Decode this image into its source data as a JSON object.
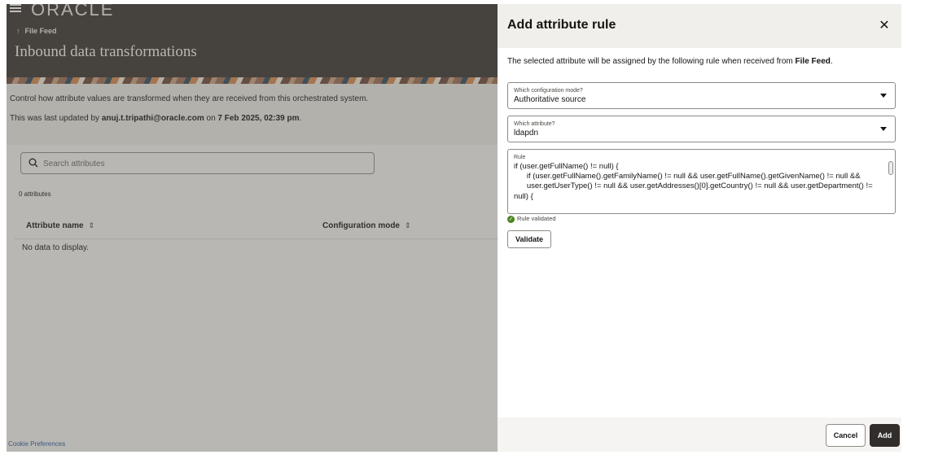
{
  "header": {
    "logo_text": "ORACLE",
    "breadcrumb": "File Feed",
    "page_title": "Inbound data transformations"
  },
  "main": {
    "description": "Control how attribute values are transformed when they are received from this orchestrated system.",
    "last_updated_prefix": "This was last updated by ",
    "last_updated_user": "anuj.t.tripathi@oracle.com",
    "last_updated_on": " on ",
    "last_updated_date": "7 Feb 2025, 02:39 pm",
    "last_updated_suffix": ".",
    "search_placeholder": "Search attributes",
    "attribute_count": "0 attributes",
    "columns": [
      "Attribute name",
      "Configuration mode"
    ],
    "empty_message": "No data to display.",
    "cookie_link": "Cookie Preferences"
  },
  "drawer": {
    "title": "Add attribute rule",
    "intro_prefix": "The selected attribute will be assigned by the following rule when received from ",
    "intro_source": "File Feed",
    "intro_suffix": ".",
    "config_mode_label": "Which configuration mode?",
    "config_mode_value": "Authoritative source",
    "attribute_label": "Which attribute?",
    "attribute_value": "ldapdn",
    "rule_label": "Rule",
    "rule_text": "if (user.getFullName() != null) {\n      if (user.getFullName().getFamilyName() != null && user.getFullName().getGivenName() != null &&\n      user.getUserType() != null && user.getAddresses()[0].getCountry() != null && user.getDepartment() != null) {",
    "rule_status": "Rule validated",
    "validate_label": "Validate",
    "cancel_label": "Cancel",
    "add_label": "Add"
  }
}
